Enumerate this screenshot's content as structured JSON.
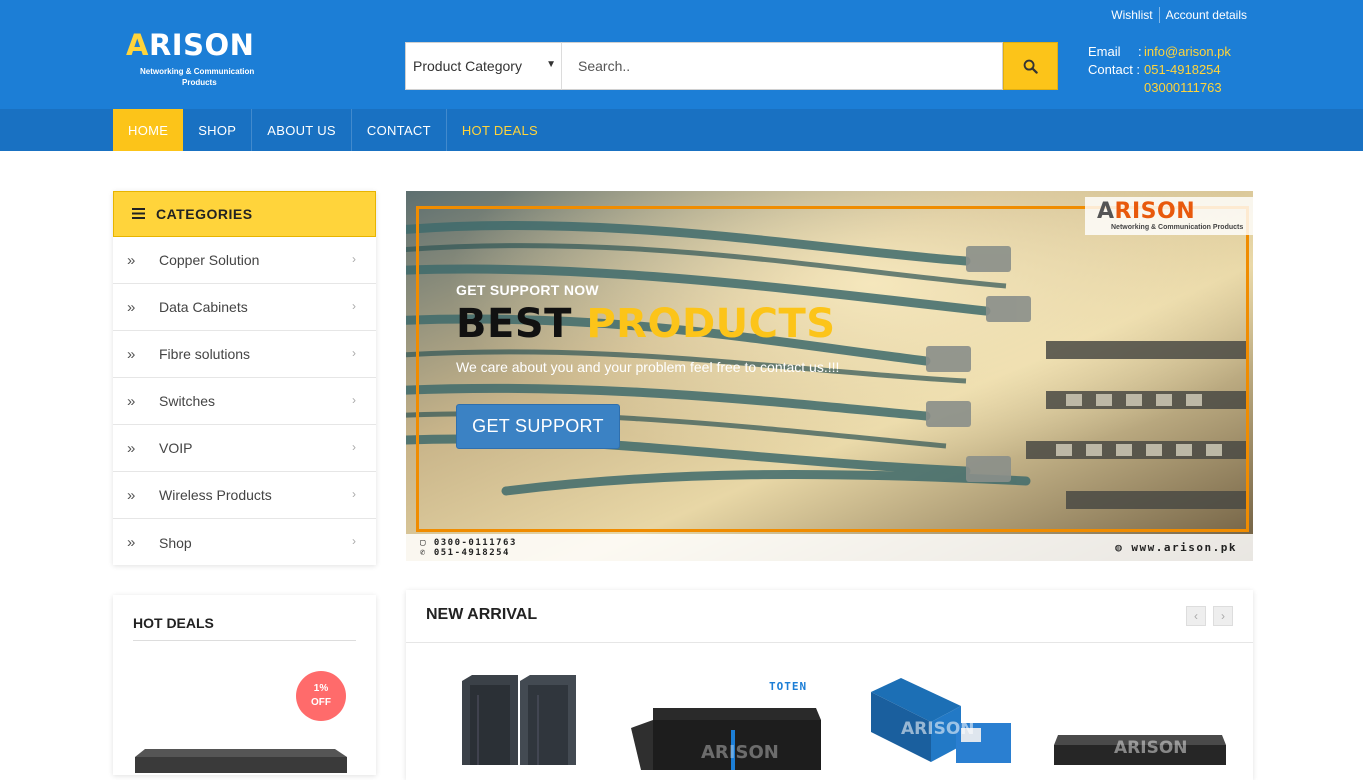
{
  "header": {
    "links": {
      "wishlist": "Wishlist",
      "account": "Account details"
    },
    "logo": {
      "letters": "RISON",
      "first": "A",
      "sub1": "Networking & Communication",
      "sub2": "Products"
    },
    "search": {
      "category": "Product Category",
      "placeholder": "Search.."
    },
    "contact": {
      "email_label": "Email",
      "email": "info@arison.pk",
      "contact_label": "Contact :",
      "phone1": "051-4918254",
      "phone2": "03000111763"
    }
  },
  "nav": [
    {
      "label": "HOME",
      "state": "active"
    },
    {
      "label": "SHOP"
    },
    {
      "label": "ABOUT US"
    },
    {
      "label": "CONTACT"
    },
    {
      "label": "HOT DEALS",
      "state": "highlight"
    }
  ],
  "categories": {
    "title": "CATEGORIES",
    "items": [
      "Copper Solution",
      "Data Cabinets",
      "Fibre solutions",
      "Switches",
      "VOIP",
      "Wireless Products",
      "Shop"
    ]
  },
  "banner": {
    "logo_first": "A",
    "logo_letters": "RISON",
    "logo_sub": "Networking & Communication",
    "logo_sub2": "Products",
    "kicker": "GET SUPPORT NOW",
    "headline_1": "BEST ",
    "headline_2": "PRODUCTS",
    "tagline": "We care about you and your problem feel free to contact us.!!!",
    "button": "GET SUPPORT",
    "phone_1": "0300-0111763",
    "phone_2": "051-4918254",
    "website": "www.arison.pk"
  },
  "hot_deals": {
    "title": "HOT DEALS",
    "badge_pct": "1%",
    "badge_off": "OFF"
  },
  "new_arrival": {
    "title": "NEW ARRIVAL",
    "brand_label": "TOTEN",
    "watermark": "ARISON"
  },
  "colors": {
    "header_blue": "#1c7ed6",
    "nav_blue": "#1971c2",
    "accent_yellow": "#fcc419",
    "link_yellow": "#ffd43b",
    "badge_red": "#ff6b6b",
    "banner_frame": "#f08c00"
  },
  "icons": {
    "search_button": "search-icon",
    "category_bullet": "double-chevron-right-icon",
    "category_arrow": "chevron-right-icon",
    "categories_header": "menu-icon",
    "carousel_prev": "chevron-left-icon",
    "carousel_next": "chevron-right-icon"
  }
}
